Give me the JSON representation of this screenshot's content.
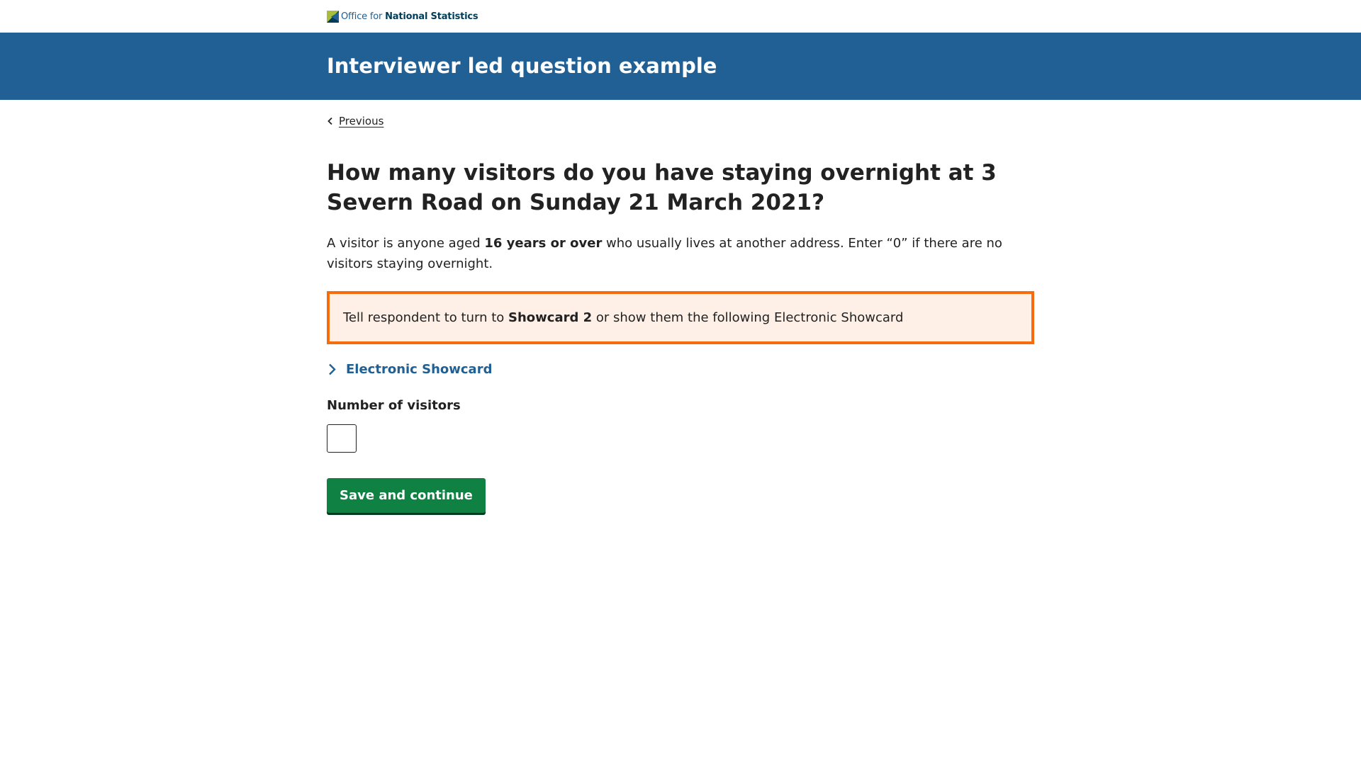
{
  "brand": {
    "logo_prefix": "Office for",
    "logo_name": "National Statistics",
    "colors": {
      "primary": "#206095",
      "logo_green": "#a8bd3a",
      "accent_orange": "#f66b0c",
      "button_green": "#0f8243"
    }
  },
  "header": {
    "title": "Interviewer led question example"
  },
  "nav": {
    "previous_label": "Previous",
    "previous_icon": "chevron-left-icon"
  },
  "question": {
    "title": "How many visitors do you have staying overnight at 3 Severn Road on Sunday 21 March 2021?",
    "description": {
      "part1": "A visitor is anyone aged ",
      "emphasis": "16 years or over",
      "part2": " who usually lives at another address. Enter “0” if there are no visitors staying overnight."
    }
  },
  "interviewer_note": {
    "part1": "Tell respondent to turn to ",
    "emphasis": "Showcard 2",
    "part2": " or show them the following Electronic Showcard"
  },
  "details": {
    "label": "Electronic Showcard",
    "icon": "chevron-right-icon",
    "expanded": false
  },
  "field": {
    "label": "Number of visitors",
    "value": "",
    "placeholder": ""
  },
  "actions": {
    "submit_label": "Save and continue"
  }
}
